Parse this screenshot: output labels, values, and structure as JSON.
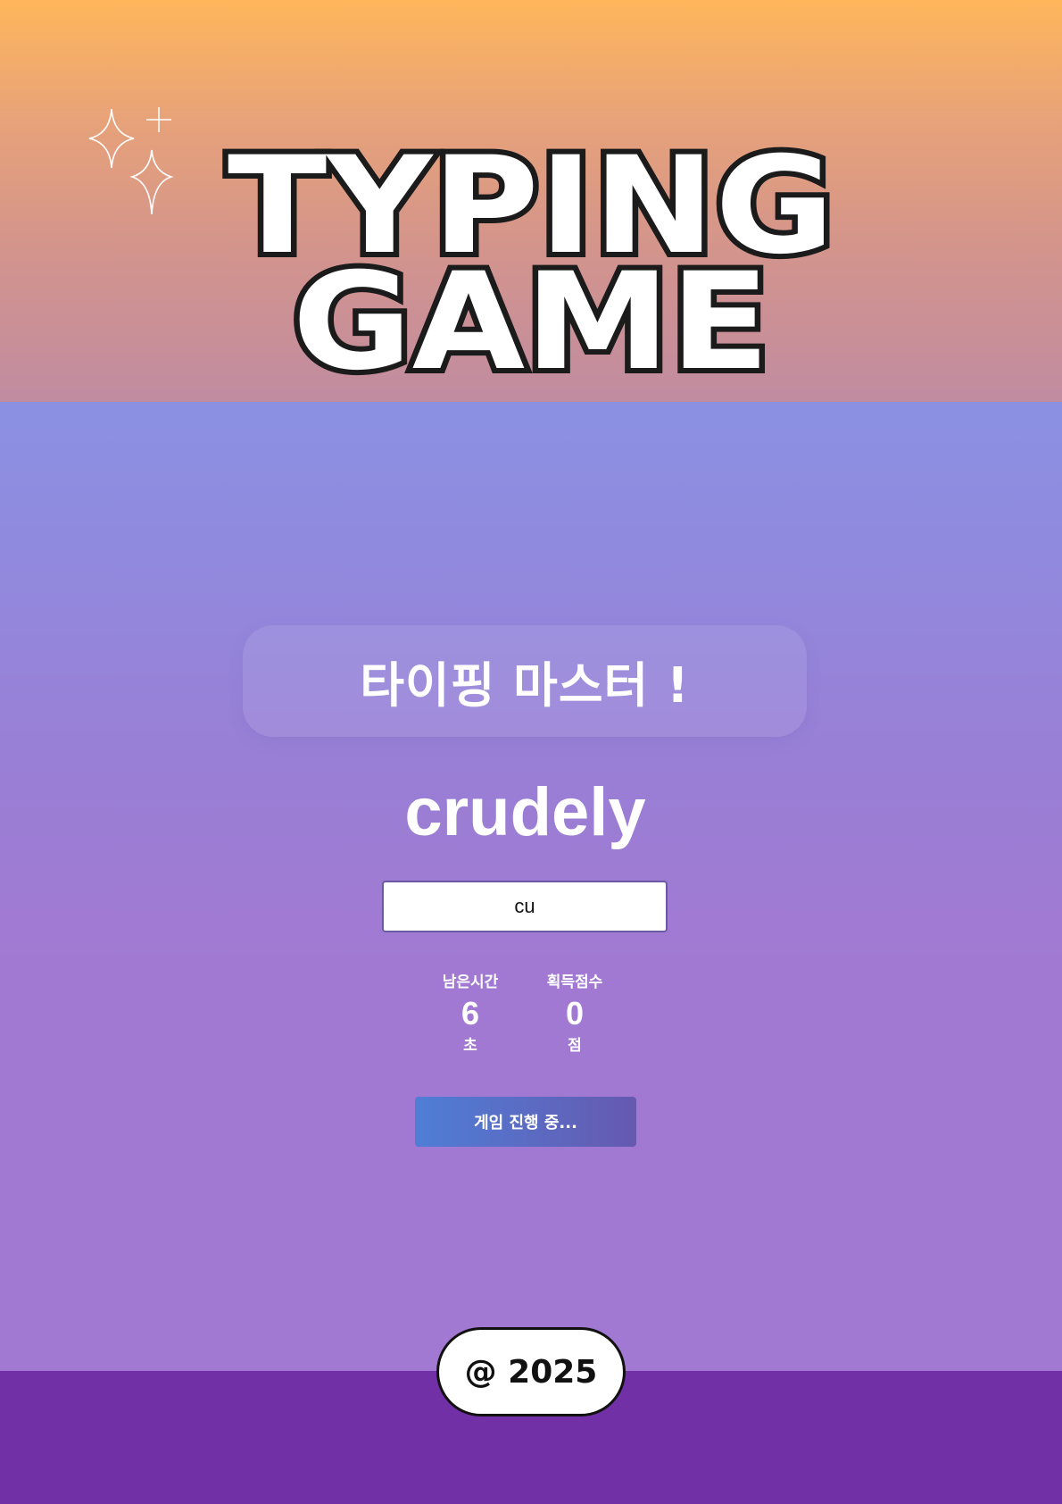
{
  "header": {
    "title_line1": "TYPING",
    "title_line2": "GAME",
    "decoration_icon": "sparkles-icon"
  },
  "game": {
    "banner_text": "타이핑 마스터 !",
    "target_word": "crudely",
    "input_value": "cu",
    "stats": {
      "time": {
        "label": "남은시간",
        "value": "6",
        "unit": "초"
      },
      "score": {
        "label": "획득점수",
        "value": "0",
        "unit": "점"
      }
    },
    "status_button_label": "게임 진행 중..."
  },
  "footer": {
    "copyright": "@ 2025"
  },
  "colors": {
    "header_top": "#ffb65b",
    "header_bottom": "#c18ca1",
    "body_top": "#76a6f8",
    "body_bottom": "#a279d2",
    "footer": "#7230a6",
    "button_start": "#4f7ed6",
    "button_end": "#6659b0"
  }
}
